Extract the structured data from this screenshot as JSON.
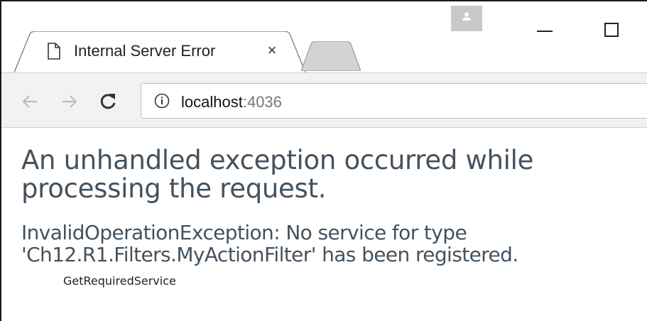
{
  "browser": {
    "tab": {
      "title": "Internal Server Error",
      "close_glyph": "×"
    },
    "address_bar": {
      "host": "localhost",
      "port": ":4036"
    },
    "icons": {
      "page": "page-icon",
      "back": "back-arrow-icon",
      "forward": "forward-arrow-icon",
      "reload": "reload-icon",
      "info": "info-icon",
      "profile": "profile-icon"
    }
  },
  "page": {
    "heading": "An unhandled exception occurred while processing the request.",
    "exception_message": "InvalidOperationException: No service for type 'Ch12.R1.Filters.MyActionFilter' has been registered.",
    "stack_frame": "GetRequiredService"
  },
  "colors": {
    "heading_text": "#44525e",
    "toolbar_bg": "#f2f2f2"
  }
}
